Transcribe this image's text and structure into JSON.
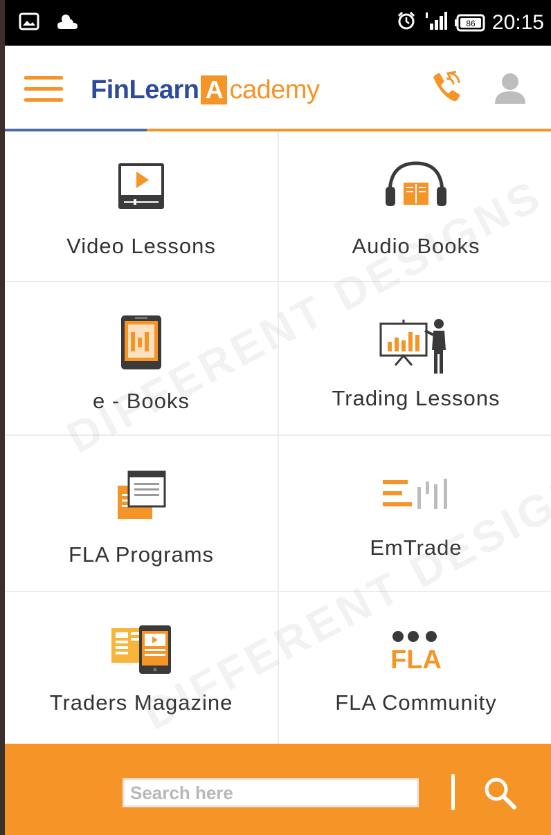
{
  "status_bar": {
    "time": "20:15",
    "battery": "86",
    "icons": [
      "image-notification-icon",
      "weather-cloud-icon",
      "alarm-icon",
      "signal-icon",
      "battery-icon"
    ]
  },
  "app_bar": {
    "brand_fin": "FinLearn",
    "brand_a": "A",
    "brand_rest": "cademy",
    "icons": [
      "menu-icon",
      "call-icon",
      "user-icon"
    ]
  },
  "menu": {
    "items": [
      {
        "label": "Video Lessons",
        "icon": "video-play-icon"
      },
      {
        "label": "Audio Books",
        "icon": "headphones-book-icon"
      },
      {
        "label": "e - Books",
        "icon": "tablet-ebook-icon"
      },
      {
        "label": "Trading Lessons",
        "icon": "presenter-chart-icon"
      },
      {
        "label": "FLA Programs",
        "icon": "windows-program-icon"
      },
      {
        "label": "EmTrade",
        "icon": "emtrade-logo-icon"
      },
      {
        "label": "Traders Magazine",
        "icon": "magazine-tablet-icon"
      },
      {
        "label": "FLA Community",
        "icon": "fla-community-icon"
      }
    ]
  },
  "search": {
    "placeholder": "Search here",
    "value": ""
  },
  "watermark": "DIFFERENT DESIGNS",
  "colors": {
    "accent": "#f59427",
    "brand_blue": "#2d4b9b",
    "status_bar": "#000000",
    "tile_border": "#ececec"
  }
}
